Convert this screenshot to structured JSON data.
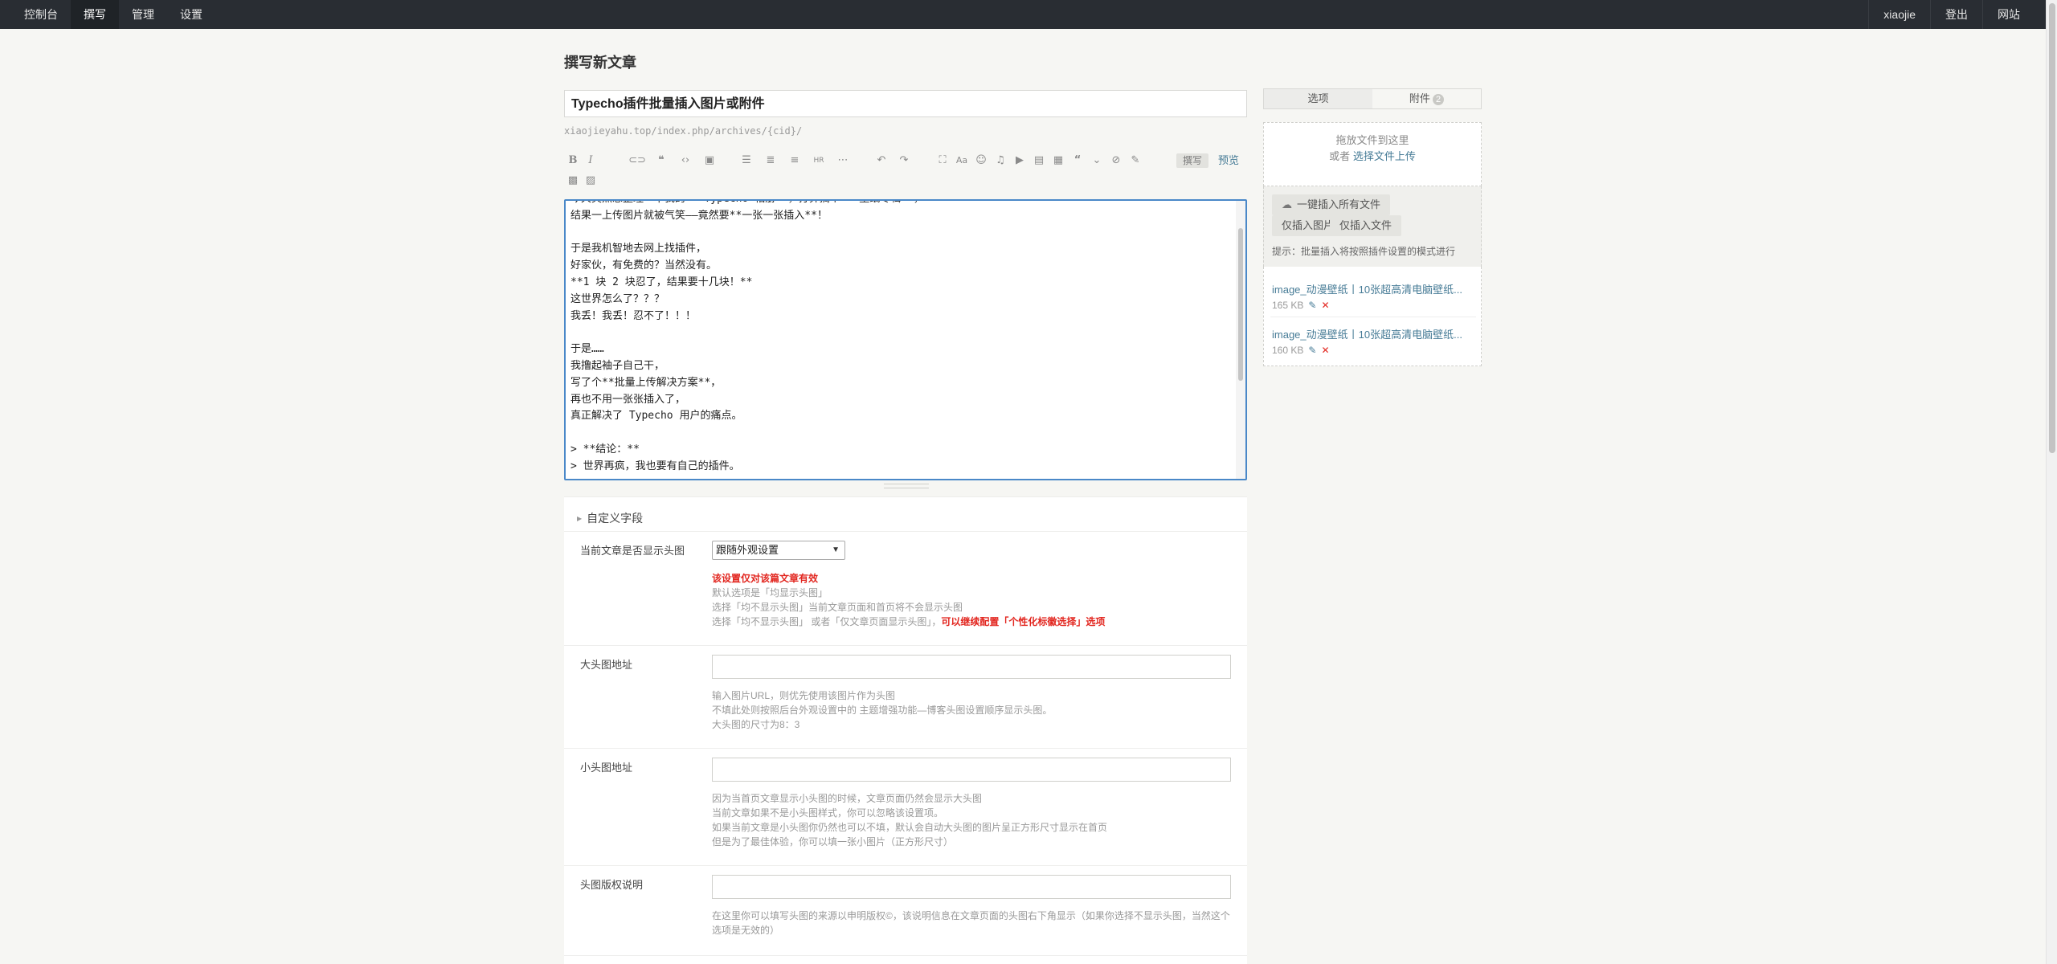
{
  "topbar": {
    "nav": [
      "控制台",
      "撰写",
      "管理",
      "设置"
    ],
    "user": "xiaojie",
    "logout": "登出",
    "site": "网站"
  },
  "page": {
    "title": "撰写新文章",
    "post_title": "Typecho插件批量插入图片或附件",
    "permalink": "xiaojieyahu.top/index.php/archives/{cid}/"
  },
  "toolbar": {
    "icons": [
      "bold-icon",
      "italic-icon",
      "link-icon",
      "quote-icon",
      "code-icon",
      "image-icon",
      "ordered-list-icon",
      "unordered-list-icon",
      "heading-icon",
      "hr-icon",
      "more-icon",
      "undo-icon",
      "redo-icon",
      "fullscreen-icon",
      "text-style-icon",
      "emoji-icon",
      "audio-icon",
      "video-icon",
      "file-icon",
      "gallery-icon",
      "quote-block-icon",
      "collapse-icon",
      "hide-icon",
      "login-visible-icon",
      "extra-1-icon",
      "extra-2-icon"
    ],
    "write_label": "撰写",
    "preview_label": "预览"
  },
  "editor": {
    "content": "今天突然想整理一下我的 **Typecho 相册**，打算搞个 **壁纸专辑**，\n结果一上传图片就被气笑——竟然要**一张一张插入**！\n\n于是我机智地去网上找插件，\n好家伙，有免费的？当然没有。\n**1 块 2 块忍了，结果要十几块！**\n这世界怎么了？？？\n我丢！我丢！忍不了！！！\n\n于是……\n我撸起袖子自己干，\n写了个**批量上传解决方案**，\n再也不用一张张插入了，\n真正解决了 Typecho 用户的痛点。\n\n> **结论：**\n> 世界再疯，我也要有自己的插件。"
  },
  "custom_fields": {
    "header": "自定义字段",
    "fields": [
      {
        "label": "当前文章是否显示头图",
        "select_value": "跟随外观设置",
        "desc_warning": "该设置仅对该篇文章有效",
        "desc_lines": [
          "默认选项是「均显示头图」",
          "选择「均不显示头图」当前文章页面和首页将不会显示头图"
        ],
        "desc_mixed": "选择「均不显示头图」 或者「仅文章页面显示头图」，",
        "desc_mixed_red": "可以继续配置「个性化标徽选择」选项"
      },
      {
        "label": "大头图地址",
        "desc_lines": [
          "输入图片URL，则优先使用该图片作为头图",
          "不填此处则按照后台外观设置中的 主题增强功能—博客头图设置顺序显示头图。",
          "大头图的尺寸为8：3"
        ]
      },
      {
        "label": "小头图地址",
        "desc_lines": [
          "因为当首页文章显示小头图的时候，文章页面仍然会显示大头图",
          "当前文章如果不是小头图样式，你可以忽略该设置项。",
          "如果当前文章是小头图你仍然也可以不填，默认会自动大头图的图片呈正方形尺寸显示在首页",
          "但是为了最佳体验，你可以填一张小图片（正方形尺寸）"
        ]
      },
      {
        "label": "头图版权说明",
        "desc_lines": [
          "在这里你可以填写头图的来源以申明版权©，该说明信息在文章页面的头图右下角显示（如果你选择不显示头图，当然这个选项是无效的）"
        ]
      }
    ]
  },
  "sidebar": {
    "tab_options": "选项",
    "tab_attachments": "附件",
    "attachment_count": "2",
    "drop_text": "拖放文件到这里",
    "or_text": "或者",
    "upload_link": "选择文件上传",
    "insert_all": "一键插入所有文件",
    "insert_images": "仅插入图片",
    "insert_files": "仅插入文件",
    "hint": "提示：批量插入将按照插件设置的模式进行",
    "files": [
      {
        "name": "image_动漫壁纸丨10张超高清电脑壁纸...",
        "size": "165 KB"
      },
      {
        "name": "image_动漫壁纸丨10张超高清电脑壁纸...",
        "size": "160 KB"
      }
    ]
  }
}
